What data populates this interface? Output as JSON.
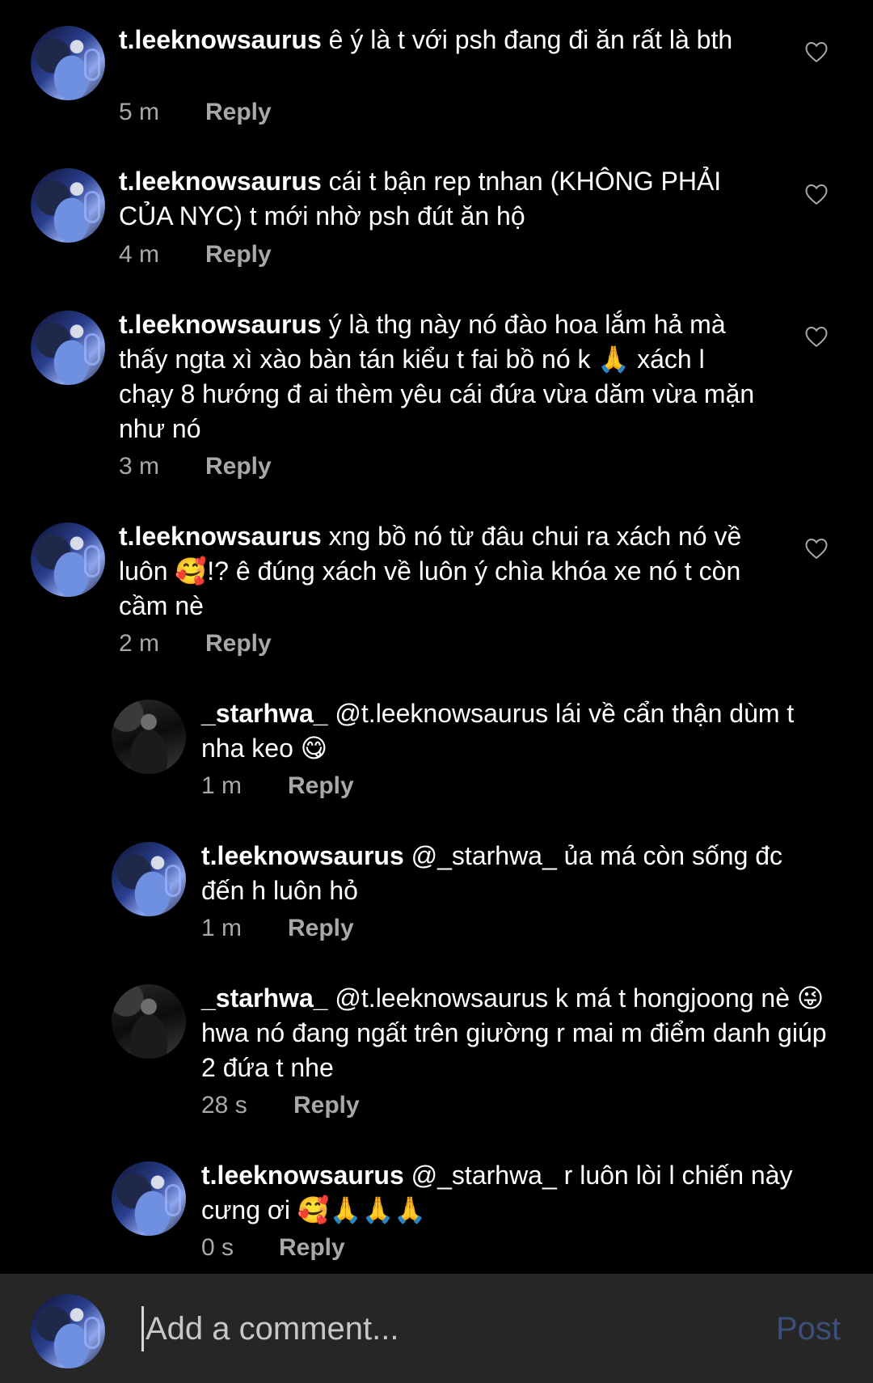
{
  "comments": [
    {
      "username": "t.leeknowsaurus",
      "text": "ê ý là t với psh đang đi ăn rất là bth",
      "time": "5 m",
      "reply_label": "Reply",
      "avatar_icon": "profile-photo-blue-icon"
    },
    {
      "username": "t.leeknowsaurus",
      "text": "cái t bận rep tnhan (KHÔNG PHẢI CỦA NYC) t mới nhờ psh đút ăn hộ",
      "time": "4 m",
      "reply_label": "Reply",
      "avatar_icon": "profile-photo-blue-icon"
    },
    {
      "username": "t.leeknowsaurus",
      "text": "ý là thg này nó đào hoa lắm hả mà thấy ngta xì xào bàn tán kiểu t fai bồ nó k 🙏 xách l chạy 8 hướng đ ai thèm yêu cái đứa vừa dăm vừa mặn như nó",
      "time": "3 m",
      "reply_label": "Reply",
      "avatar_icon": "profile-photo-blue-icon"
    },
    {
      "username": "t.leeknowsaurus",
      "text": "xng bồ nó từ đâu chui ra xách nó về luôn 🥰!? ê đúng xách về luôn ý chìa khóa xe nó t còn cầm nè",
      "time": "2 m",
      "reply_label": "Reply",
      "avatar_icon": "profile-photo-blue-icon"
    }
  ],
  "replies": [
    {
      "username": "_starhwa_",
      "text": "@t.leeknowsaurus lái về cẩn thận dùm t nha keo 😋",
      "time": "1 m",
      "reply_label": "Reply",
      "avatar_icon": "profile-photo-dark-icon"
    },
    {
      "username": "t.leeknowsaurus",
      "text": "@_starhwa_ ủa má còn sống đc đến h luôn hỏ",
      "time": "1 m",
      "reply_label": "Reply",
      "avatar_icon": "profile-photo-blue-icon"
    },
    {
      "username": "_starhwa_",
      "text": "@t.leeknowsaurus k má t hongjoong nè 😜 hwa nó đang ngất trên giường r mai m điểm danh giúp 2 đứa t nhe",
      "time": "28 s",
      "reply_label": "Reply",
      "avatar_icon": "profile-photo-dark-icon"
    },
    {
      "username": "t.leeknowsaurus",
      "text": "@_starhwa_ r luôn lòi l chiến này cưng ơi 🥰🙏🙏🙏",
      "time": "0 s",
      "reply_label": "Reply",
      "avatar_icon": "profile-photo-blue-icon"
    }
  ],
  "composer": {
    "placeholder": "Add a comment...",
    "post_label": "Post",
    "avatar_icon": "profile-photo-blue-icon"
  },
  "colors": {
    "background": "#000000",
    "text": "#ffffff",
    "meta": "#a8a8a8",
    "composer_bg": "#262626",
    "post_disabled": "#3b4f7a"
  }
}
